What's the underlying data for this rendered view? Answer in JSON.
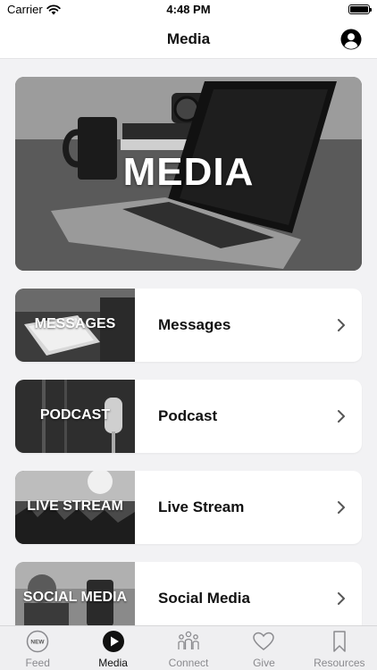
{
  "status_bar": {
    "carrier": "Carrier",
    "time": "4:48 PM"
  },
  "nav": {
    "title": "Media",
    "profile_icon": "person-circle-icon"
  },
  "hero": {
    "title": "MEDIA"
  },
  "cards": [
    {
      "thumb_label": "MESSAGES",
      "label": "Messages"
    },
    {
      "thumb_label": "PODCAST",
      "label": "Podcast"
    },
    {
      "thumb_label": "LIVE STREAM",
      "label": "Live Stream"
    },
    {
      "thumb_label": "SOCIAL MEDIA",
      "label": "Social Media"
    }
  ],
  "tabs": [
    {
      "label": "Feed",
      "icon": "new-badge-icon",
      "badge": "NEW",
      "active": false
    },
    {
      "label": "Media",
      "icon": "play-circle-icon",
      "active": true
    },
    {
      "label": "Connect",
      "icon": "people-icon",
      "active": false
    },
    {
      "label": "Give",
      "icon": "heart-icon",
      "active": false
    },
    {
      "label": "Resources",
      "icon": "bookmark-icon",
      "active": false
    }
  ],
  "colors": {
    "active_tab": "#111111",
    "inactive_tab": "#8a8a8e",
    "background": "#f2f2f4"
  }
}
